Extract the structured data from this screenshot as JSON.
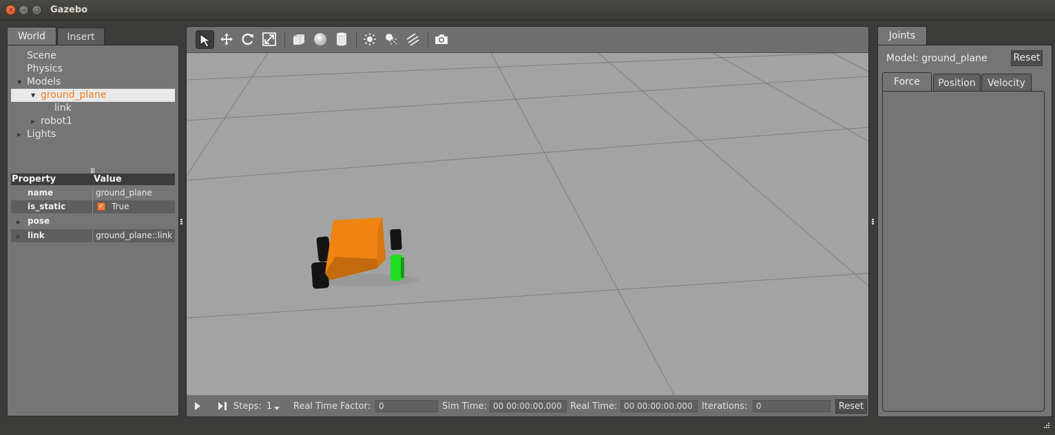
{
  "window": {
    "title": "Gazebo",
    "close_glyph": "×",
    "min_glyph": "–",
    "max_glyph": "□"
  },
  "left": {
    "tabs": [
      {
        "label": "World",
        "active": true
      },
      {
        "label": "Insert",
        "active": false
      }
    ],
    "tree": {
      "scene": "Scene",
      "physics": "Physics",
      "models": "Models",
      "ground_plane": "ground_plane",
      "link": "link",
      "robot1": "robot1",
      "lights": "Lights"
    },
    "properties": {
      "header_property": "Property",
      "header_value": "Value",
      "rows": [
        {
          "key": "name",
          "value": "ground_plane"
        },
        {
          "key": "is_static",
          "value": "True",
          "checked": true
        },
        {
          "key": "pose",
          "value": ""
        },
        {
          "key": "link",
          "value": "ground_plane::link"
        }
      ]
    }
  },
  "toolbar": {
    "tools": [
      "select-arrow-icon",
      "translate-icon",
      "rotate-icon",
      "scale-icon",
      "box-icon",
      "sphere-icon",
      "cylinder-icon",
      "point-light-icon",
      "spot-light-icon",
      "directional-light-icon",
      "screenshot-camera-icon"
    ]
  },
  "bottombar": {
    "steps_label": "Steps:",
    "steps_value": "1",
    "rtf_label": "Real Time Factor:",
    "rtf_value": "0",
    "sim_time_label": "Sim Time:",
    "sim_time_value": "00 00:00:00.000",
    "real_time_label": "Real Time:",
    "real_time_value": "00 00:00:00.000",
    "iterations_label": "Iterations:",
    "iterations_value": "0",
    "reset_label": "Reset"
  },
  "right": {
    "tab": "Joints",
    "model_label": "Model: ground_plane",
    "reset_label": "Reset",
    "tabs": [
      {
        "label": "Force",
        "active": true
      },
      {
        "label": "Position",
        "active": false
      },
      {
        "label": "Velocity",
        "active": false
      }
    ]
  },
  "colors": {
    "accent": "#f07c3c",
    "scene": "#a3a3a3",
    "robot_body": "#ef8412",
    "wheel_active": "#22dd22"
  }
}
